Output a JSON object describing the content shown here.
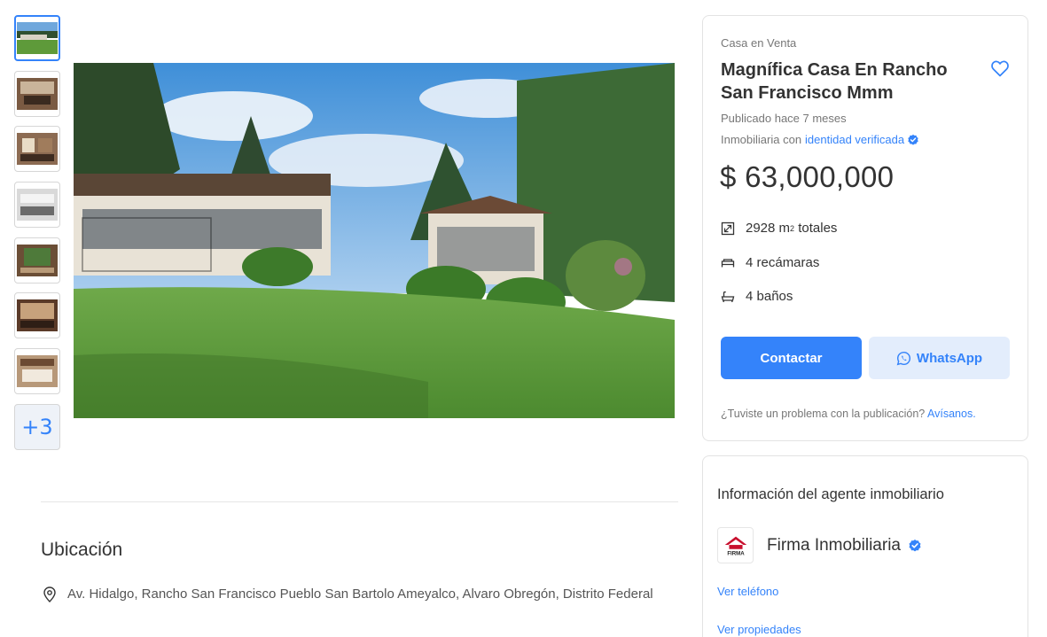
{
  "gallery": {
    "thumbnails": [
      "thumb-house-exterior",
      "thumb-living-room",
      "thumb-dining-room",
      "thumb-kitchen",
      "thumb-atrium",
      "thumb-hall",
      "thumb-bedroom"
    ],
    "more_label": "+3"
  },
  "listing": {
    "category": "Casa en Venta",
    "title": "Magnífica Casa En Rancho San Francisco Mmm",
    "published": "Publicado hace 7 meses",
    "agency_prefix": "Inmobiliaria con",
    "agency_link": "identidad verificada",
    "price": "$ 63,000,000",
    "features": [
      {
        "icon": "area-icon",
        "text": "2928 m",
        "sup": "2",
        "suffix": " totales"
      },
      {
        "icon": "bed-icon",
        "text": "4 recámaras"
      },
      {
        "icon": "bath-icon",
        "text": "4 baños"
      }
    ],
    "contact_label": "Contactar",
    "whatsapp_label": "WhatsApp",
    "problem_text": "¿Tuviste un problema con la publicación?",
    "problem_link": "Avísanos."
  },
  "location": {
    "title": "Ubicación",
    "address": "Av. Hidalgo, Rancho San Francisco Pueblo San Bartolo Ameyalco, Alvaro Obregón, Distrito Federal"
  },
  "agent": {
    "section_title": "Información del agente inmobiliario",
    "name": "Firma Inmobiliaria",
    "logo_text": "FIRMA",
    "phone_link": "Ver teléfono",
    "properties_link": "Ver propiedades"
  },
  "colors": {
    "accent": "#3483fa",
    "whatsapp_bg": "#e3edfc",
    "logo_red": "#c8102e"
  }
}
